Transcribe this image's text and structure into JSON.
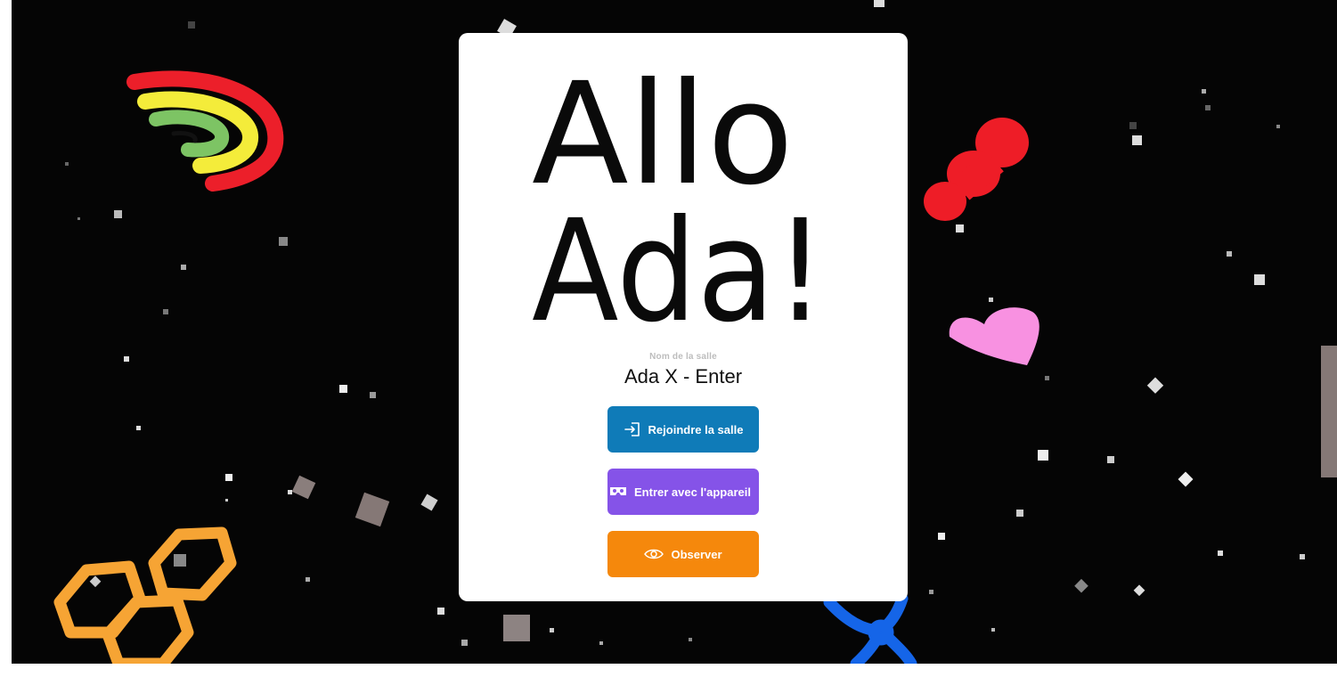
{
  "logo": {
    "line1": "Allo",
    "line2": "Ada!"
  },
  "room": {
    "caption": "Nom de la salle",
    "name": "Ada X - Enter"
  },
  "buttons": {
    "join": {
      "label": "Rejoindre la salle",
      "icon": "sign-in-icon",
      "color": "#0f7bb8"
    },
    "device": {
      "label": "Entrer avec l'appareil",
      "icon": "vr-headset-icon",
      "color": "#8553e8"
    },
    "observe": {
      "label": "Observer",
      "icon": "eye-icon",
      "color": "#f5880c"
    }
  },
  "background": {
    "color": "#050505",
    "decorations": [
      "rainbow-shape",
      "red-blob-shape",
      "pink-heart-shape",
      "orange-hexagons-shape",
      "blue-flower-shape",
      "floating-cubes"
    ]
  }
}
